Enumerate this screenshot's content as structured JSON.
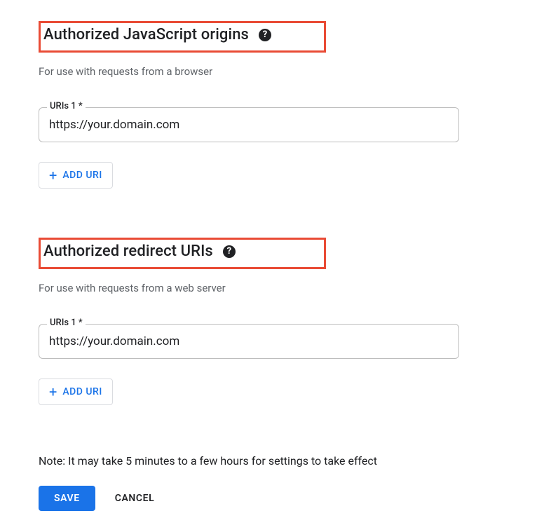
{
  "jsOrigins": {
    "heading": "Authorized JavaScript origins",
    "subtext": "For use with requests from a browser",
    "fieldLabel": "URIs 1 *",
    "fieldValue": "https://your.domain.com",
    "addLabel": "ADD URI"
  },
  "redirectUris": {
    "heading": "Authorized redirect URIs",
    "subtext": "For use with requests from a web server",
    "fieldLabel": "URIs 1 *",
    "fieldValue": "https://your.domain.com",
    "addLabel": "ADD URI"
  },
  "note": "Note: It may take 5 minutes to a few hours for settings to take effect",
  "actions": {
    "save": "SAVE",
    "cancel": "CANCEL"
  }
}
